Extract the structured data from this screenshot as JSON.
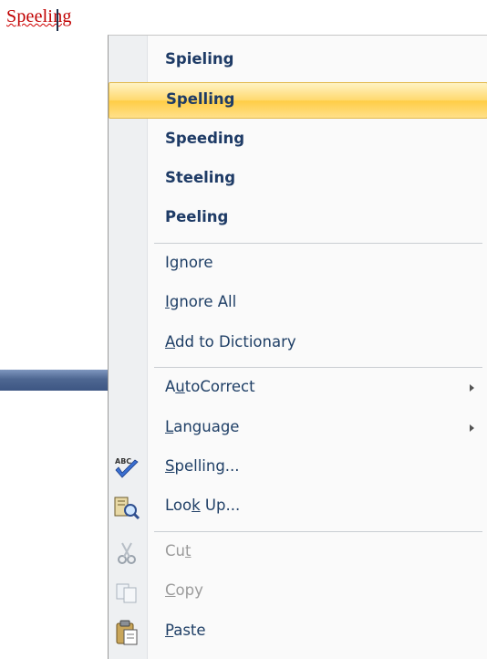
{
  "document": {
    "misspelled_word": "Speeling"
  },
  "menu": {
    "suggestions": [
      "Spieling",
      "Spelling",
      "Speeding",
      "Steeling",
      "Peeling"
    ],
    "ignore": {
      "pre": "I",
      "acc": "g",
      "post": "nore"
    },
    "ignore_all": {
      "pre": "",
      "acc": "I",
      "post": "gnore All"
    },
    "add_to_dictionary": {
      "pre": "",
      "acc": "A",
      "post": "dd to Dictionary"
    },
    "autocorrect": {
      "pre": "A",
      "acc": "u",
      "post": "toCorrect"
    },
    "language": {
      "pre": "",
      "acc": "L",
      "post": "anguage"
    },
    "spelling": {
      "pre": "",
      "acc": "S",
      "post": "pelling..."
    },
    "look_up": {
      "pre": "Loo",
      "acc": "k",
      "post": " Up..."
    },
    "cut": {
      "pre": "Cu",
      "acc": "t",
      "post": ""
    },
    "copy": {
      "pre": "",
      "acc": "C",
      "post": "opy"
    },
    "paste": {
      "pre": "",
      "acc": "P",
      "post": "aste"
    },
    "highlighted_item": "Spelling"
  },
  "icons": {
    "spelling": "spell-check-abc-icon",
    "look_up": "research-book-magnifier-icon",
    "cut": "scissors-icon",
    "copy": "copy-pages-icon",
    "paste": "clipboard-paste-icon"
  },
  "colors": {
    "highlight": "#ffd96e",
    "menu_text": "#1f3f66",
    "disabled_text": "#9b9b9b",
    "misspelling": "#c00000"
  }
}
